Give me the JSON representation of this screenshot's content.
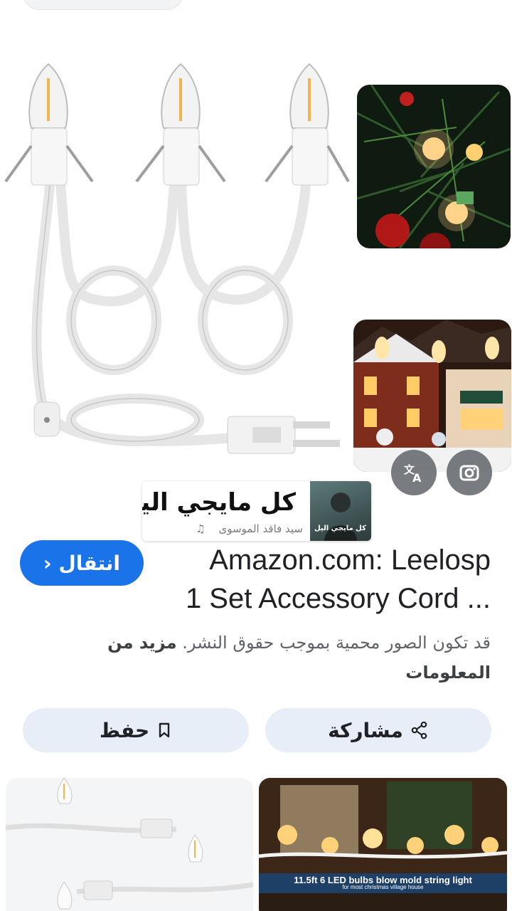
{
  "sticker": {
    "title": "كل مايجي اليل",
    "artist": "سيد فاقد الموسوى",
    "art_text": "كل مايجي اليل"
  },
  "visit_label": "انتقال",
  "product_title_line1": "Amazon.com: Leelosp",
  "product_title_line2": "1 Set Accessory Cord ...",
  "copyright_text": "قد تكون الصور محمية بموجب حقوق النشر.",
  "copyright_more": "مزيد من المعلومات",
  "actions": {
    "share": "مشاركة",
    "save": "حفظ"
  },
  "bottom_banner": {
    "line1": "11.5ft 6 LED bulbs blow mold string light",
    "line2": "for most christmas village house"
  },
  "icons": {
    "translate": "translate-icon",
    "lens": "lens-icon",
    "share": "share-icon",
    "save": "bookmark-icon",
    "music": "music-note-icon"
  },
  "colors": {
    "accent": "#1a73e8",
    "action_bg": "#e8eef7"
  }
}
